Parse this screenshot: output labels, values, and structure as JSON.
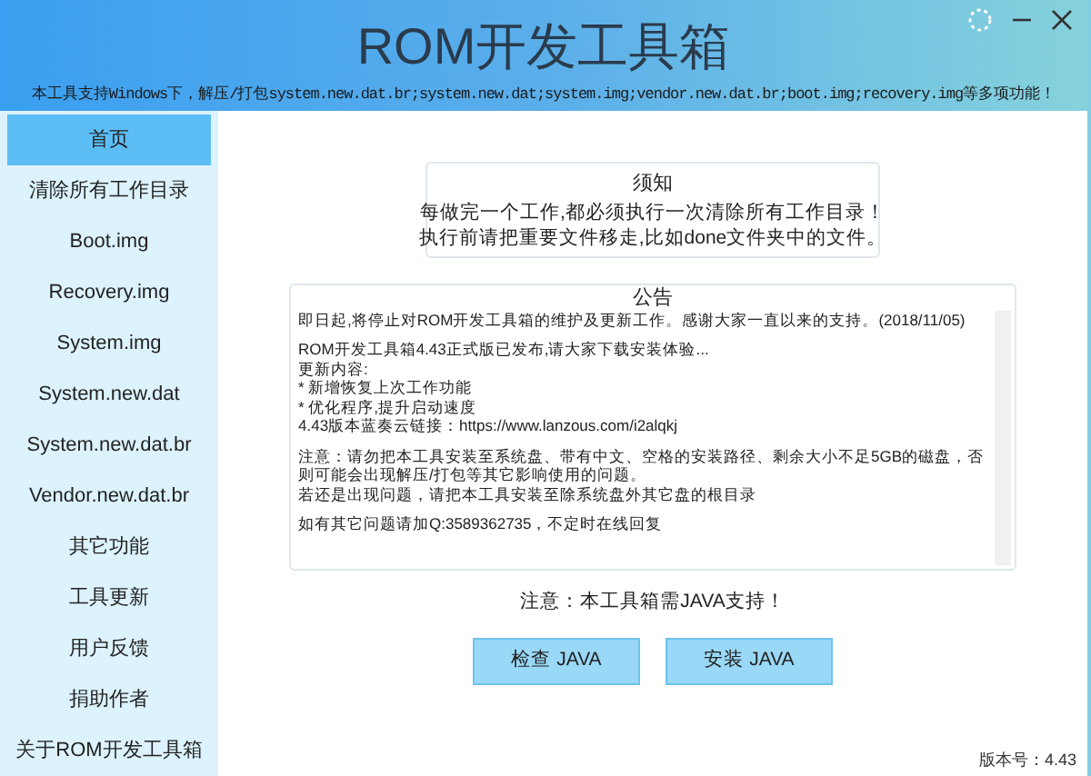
{
  "window": {
    "title": "ROM开发工具箱",
    "subtitle": "本工具支持Windows下，解压/打包system.new.dat.br;system.new.dat;system.img;vendor.new.dat.br;boot.img;recovery.img等多项功能！"
  },
  "sidebar": {
    "items": [
      {
        "label": "首页",
        "selected": true
      },
      {
        "label": "清除所有工作目录",
        "selected": false
      },
      {
        "label": "Boot.img",
        "selected": false
      },
      {
        "label": "Recovery.img",
        "selected": false
      },
      {
        "label": "System.img",
        "selected": false
      },
      {
        "label": "System.new.dat",
        "selected": false
      },
      {
        "label": "System.new.dat.br",
        "selected": false
      },
      {
        "label": "Vendor.new.dat.br",
        "selected": false
      },
      {
        "label": "其它功能",
        "selected": false
      },
      {
        "label": "工具更新",
        "selected": false
      },
      {
        "label": "用户反馈",
        "selected": false
      },
      {
        "label": "捐助作者",
        "selected": false
      },
      {
        "label": "关于ROM开发工具箱",
        "selected": false
      }
    ]
  },
  "notice": {
    "title": "须知",
    "lines": [
      "每做完一个工作,都必须执行一次清除所有工作目录！",
      "执行前请把重要文件移走,比如done文件夹中的文件。"
    ]
  },
  "announcement": {
    "title": "公告",
    "paragraphs": [
      [
        "即日起,将停止对ROM开发工具箱的维护及更新工作。感谢大家一直以来的支持。(2018/11/05)"
      ],
      [
        "ROM开发工具箱4.43正式版已发布,请大家下载安装体验...",
        "更新内容:",
        "* 新增恢复上次工作功能",
        "* 优化程序,提升启动速度",
        "4.43版本蓝奏云链接：https://www.lanzous.com/i2alqkj"
      ],
      [
        "注意：请勿把本工具安装至系统盘、带有中文、空格的安装路径、剩余大小不足5GB的磁盘，否则可能会出现解压/打包等其它影响使用的问题。",
        "若还是出现问题，请把本工具安装至除系统盘外其它盘的根目录"
      ],
      [
        "如有其它问题请加Q:3589362735，不定时在线回复"
      ]
    ]
  },
  "java_note": "注意：本工具箱需JAVA支持！",
  "buttons": [
    "检查 JAVA",
    "安装 JAVA"
  ],
  "version": "版本号：4.43"
}
